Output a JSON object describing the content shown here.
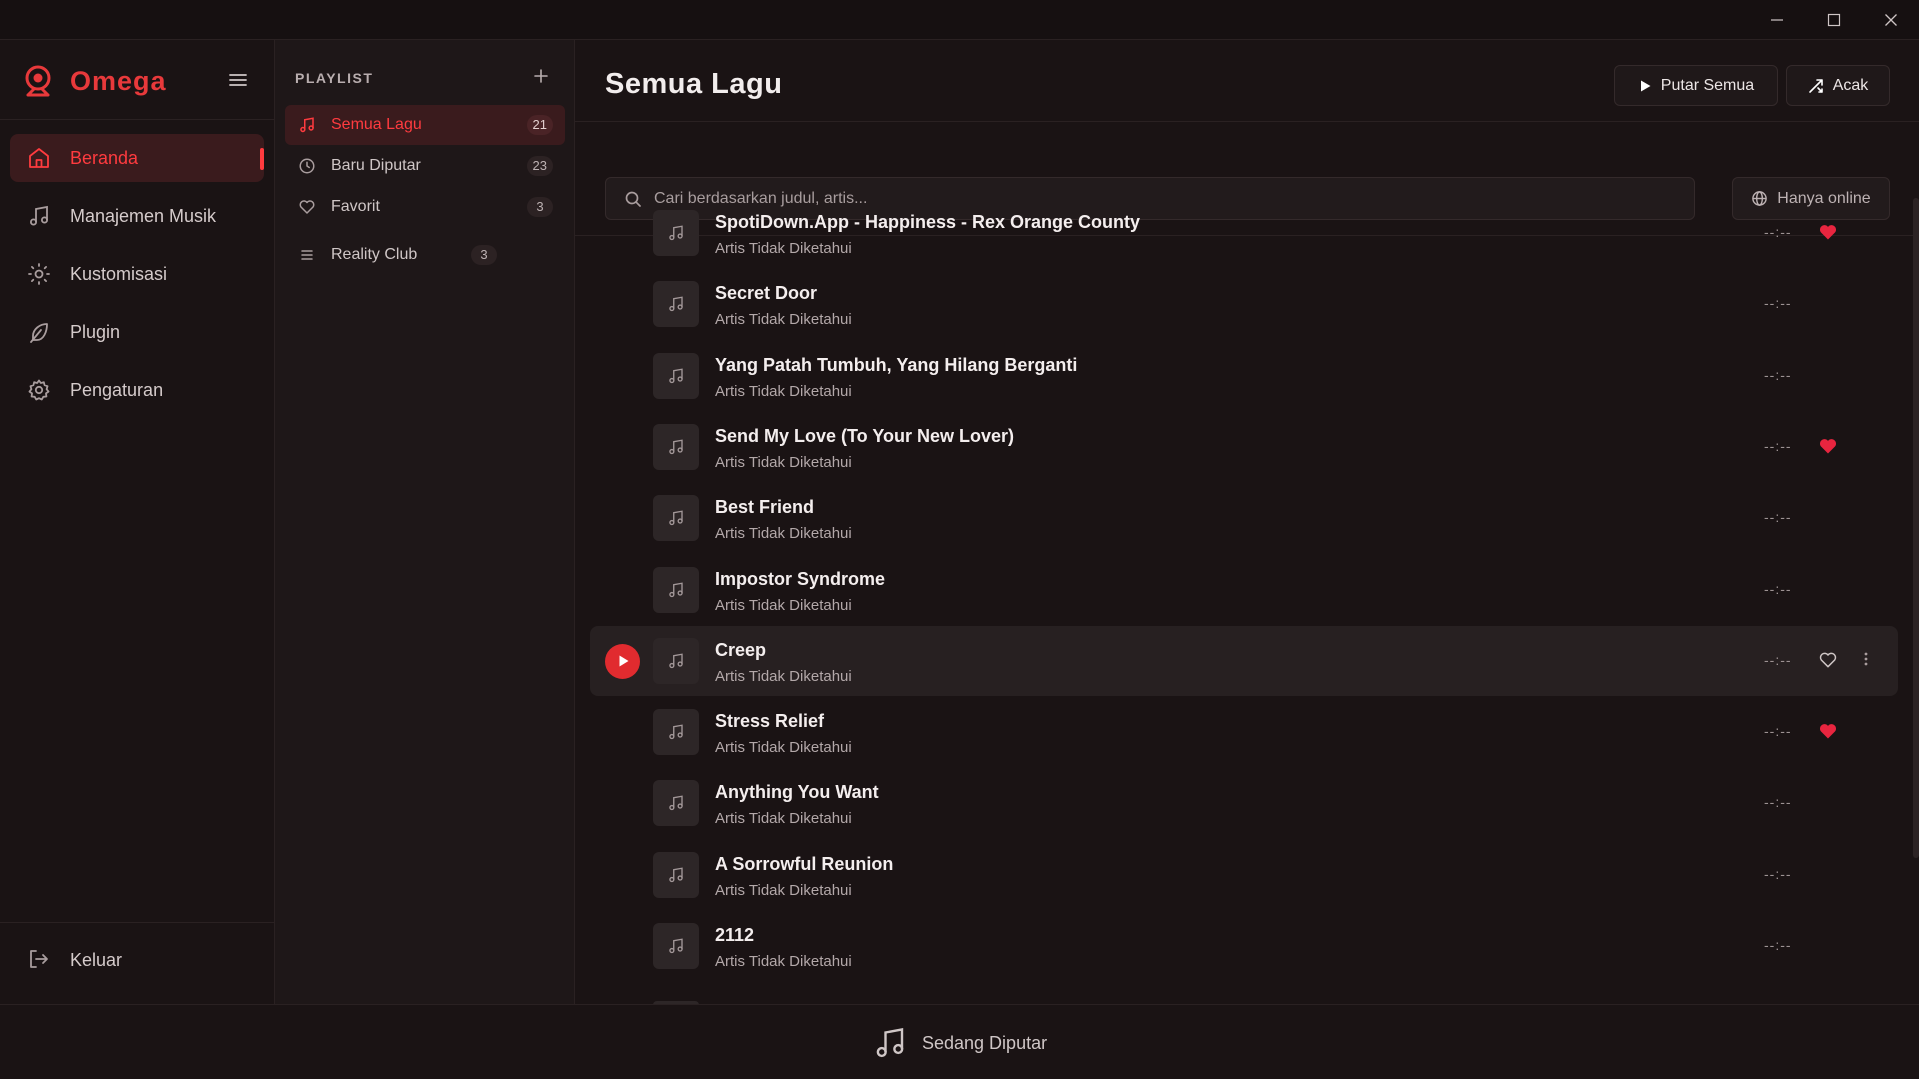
{
  "app": {
    "name": "Omega"
  },
  "window": {
    "controls": [
      "minimize-icon",
      "maximize-icon",
      "close-icon"
    ]
  },
  "sidebar": {
    "items": [
      {
        "label": "Beranda",
        "icon": "home-icon",
        "active": true
      },
      {
        "label": "Manajemen Musik",
        "icon": "music-note-icon",
        "active": false
      },
      {
        "label": "Kustomisasi",
        "icon": "sun-icon",
        "active": false
      },
      {
        "label": "Plugin",
        "icon": "feather-icon",
        "active": false
      },
      {
        "label": "Pengaturan",
        "icon": "gear-icon",
        "active": false
      }
    ],
    "logout_label": "Keluar"
  },
  "playlist": {
    "header": "PLAYLIST",
    "items": [
      {
        "label": "Semua Lagu",
        "count": "21",
        "icon": "music-note-icon",
        "active": true
      },
      {
        "label": "Baru Diputar",
        "count": "23",
        "icon": "clock-icon",
        "active": false
      },
      {
        "label": "Favorit",
        "count": "3",
        "icon": "heart-icon",
        "active": false
      }
    ],
    "custom": [
      {
        "label": "Reality Club",
        "count": "3",
        "icon": "list-icon"
      }
    ]
  },
  "main": {
    "title": "Semua Lagu",
    "play_all_label": "Putar Semua",
    "shuffle_label": "Acak",
    "search_placeholder": "Cari berdasarkan judul, artis...",
    "online_label": "Hanya online"
  },
  "songs": [
    {
      "title": "SpotiDown.App - Happiness - Rex Orange County",
      "artist": "Artis Tidak Diketahui",
      "duration": "--:--",
      "favorite": true
    },
    {
      "title": "Secret Door",
      "artist": "Artis Tidak Diketahui",
      "duration": "--:--",
      "favorite": false
    },
    {
      "title": "Yang Patah Tumbuh, Yang Hilang Berganti",
      "artist": "Artis Tidak Diketahui",
      "duration": "--:--",
      "favorite": false
    },
    {
      "title": "Send My Love (To Your New Lover)",
      "artist": "Artis Tidak Diketahui",
      "duration": "--:--",
      "favorite": true
    },
    {
      "title": "Best Friend",
      "artist": "Artis Tidak Diketahui",
      "duration": "--:--",
      "favorite": false
    },
    {
      "title": "Impostor Syndrome",
      "artist": "Artis Tidak Diketahui",
      "duration": "--:--",
      "favorite": false
    },
    {
      "title": "Creep",
      "artist": "Artis Tidak Diketahui",
      "duration": "--:--",
      "favorite": false,
      "hovered": true
    },
    {
      "title": "Stress Relief",
      "artist": "Artis Tidak Diketahui",
      "duration": "--:--",
      "favorite": true
    },
    {
      "title": "Anything You Want",
      "artist": "Artis Tidak Diketahui",
      "duration": "--:--",
      "favorite": false
    },
    {
      "title": "A Sorrowful Reunion",
      "artist": "Artis Tidak Diketahui",
      "duration": "--:--",
      "favorite": false
    },
    {
      "title": "2112",
      "artist": "Artis Tidak Diketahui",
      "duration": "--:--",
      "favorite": false
    }
  ],
  "now_playing": {
    "label": "Sedang Diputar"
  },
  "colors": {
    "accent": "#ff3b3f",
    "background": "#1a1314",
    "favorite": "#e8253f"
  }
}
